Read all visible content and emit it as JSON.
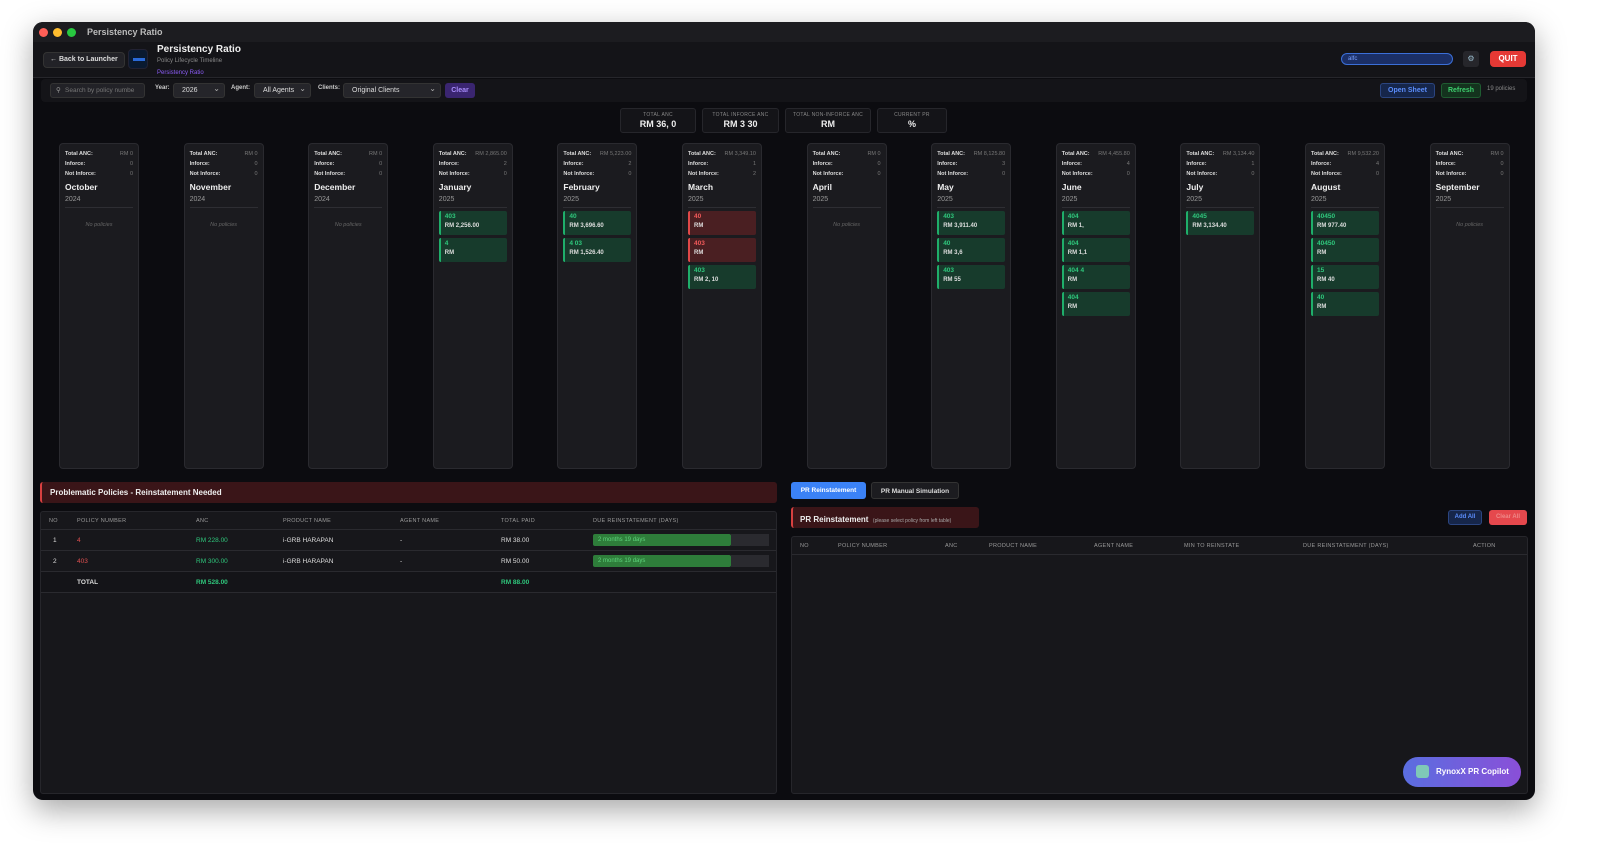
{
  "window": {
    "title": "Persistency Ratio"
  },
  "header": {
    "back": "← Back to Launcher",
    "title": "Persistency Ratio",
    "subtitle": "Policy Lifecycle Timeline",
    "link": "Persistency Ratio",
    "user": "alfc",
    "quit": "QUIT"
  },
  "filters": {
    "search_placeholder": "Search by policy numbe",
    "year_label": "Year:",
    "year": "2026",
    "agent_label": "Agent:",
    "agent": "All Agents",
    "clients_label": "Clients:",
    "clients": "Original Clients",
    "clear": "Clear",
    "open_sheet": "Open Sheet",
    "refresh": "Refresh",
    "count": "19 policies"
  },
  "stats": [
    {
      "label": "TOTAL ANC",
      "value": "RM 36,   0"
    },
    {
      "label": "TOTAL INFORCE ANC",
      "value": "RM 3    30"
    },
    {
      "label": "TOTAL NON-INFORCE ANC",
      "value": "RM"
    },
    {
      "label": "CURRENT PR",
      "value": "%"
    }
  ],
  "month_labels": {
    "total": "Total ANC:",
    "inforce": "Inforce:",
    "not_inforce": "Not Inforce:",
    "none": "No policies"
  },
  "months": [
    {
      "name": "October",
      "year": "2024",
      "total": "RM 0",
      "inforce": "0",
      "not_inforce": "0",
      "policies": []
    },
    {
      "name": "November",
      "year": "2024",
      "total": "RM 0",
      "inforce": "0",
      "not_inforce": "0",
      "policies": []
    },
    {
      "name": "December",
      "year": "2024",
      "total": "RM 0",
      "inforce": "0",
      "not_inforce": "0",
      "policies": []
    },
    {
      "name": "January",
      "year": "2025",
      "total": "RM 2,865.00",
      "inforce": "2",
      "not_inforce": "0",
      "policies": [
        {
          "no": "403",
          "anc": "RM 2,256.00",
          "status": "inforce"
        },
        {
          "no": "4",
          "anc": "RM",
          "status": "inforce"
        }
      ]
    },
    {
      "name": "February",
      "year": "2025",
      "total": "RM 5,223.00",
      "inforce": "2",
      "not_inforce": "0",
      "policies": [
        {
          "no": "40",
          "anc": "RM 3,696.60",
          "status": "inforce"
        },
        {
          "no": "4   03",
          "anc": "RM 1,526.40",
          "status": "inforce"
        }
      ]
    },
    {
      "name": "March",
      "year": "2025",
      "total": "RM 3,349.10",
      "inforce": "1",
      "not_inforce": "2",
      "policies": [
        {
          "no": "40",
          "anc": "RM",
          "status": "lapsed"
        },
        {
          "no": "403",
          "anc": "RM",
          "status": "lapsed"
        },
        {
          "no": "403",
          "anc": "RM 2,   10",
          "status": "inforce"
        }
      ]
    },
    {
      "name": "April",
      "year": "2025",
      "total": "RM 0",
      "inforce": "0",
      "not_inforce": "0",
      "policies": []
    },
    {
      "name": "May",
      "year": "2025",
      "total": "RM 8,125.80",
      "inforce": "3",
      "not_inforce": "0",
      "policies": [
        {
          "no": "403",
          "anc": "RM 3,911.40",
          "status": "inforce"
        },
        {
          "no": "40",
          "anc": "RM 3,6",
          "status": "inforce"
        },
        {
          "no": "403",
          "anc": "RM 55",
          "status": "inforce"
        }
      ]
    },
    {
      "name": "June",
      "year": "2025",
      "total": "RM 4,455.80",
      "inforce": "4",
      "not_inforce": "0",
      "policies": [
        {
          "no": "404",
          "anc": "RM 1,",
          "status": "inforce"
        },
        {
          "no": "404",
          "anc": "RM 1,1",
          "status": "inforce"
        },
        {
          "no": "404    4",
          "anc": "RM",
          "status": "inforce"
        },
        {
          "no": "404",
          "anc": "RM",
          "status": "inforce"
        }
      ]
    },
    {
      "name": "July",
      "year": "2025",
      "total": "RM 3,134.40",
      "inforce": "1",
      "not_inforce": "0",
      "policies": [
        {
          "no": "4045",
          "anc": "RM 3,134.40",
          "status": "inforce"
        }
      ]
    },
    {
      "name": "August",
      "year": "2025",
      "total": "RM 9,532.20",
      "inforce": "4",
      "not_inforce": "0",
      "policies": [
        {
          "no": "40450",
          "anc": "RM 977.40",
          "status": "inforce"
        },
        {
          "no": "40450",
          "anc": "RM",
          "status": "inforce"
        },
        {
          "no": "15",
          "anc": "RM    40",
          "status": "inforce"
        },
        {
          "no": "40",
          "anc": "RM",
          "status": "inforce"
        }
      ]
    },
    {
      "name": "September",
      "year": "2025",
      "total": "RM 0",
      "inforce": "0",
      "not_inforce": "0",
      "policies": []
    }
  ],
  "problematic": {
    "title": "Problematic Policies - Reinstatement Needed",
    "columns": [
      "NO",
      "POLICY NUMBER",
      "ANC",
      "PRODUCT NAME",
      "AGENT NAME",
      "TOTAL PAID",
      "DUE REINSTATEMENT (DAYS)"
    ],
    "rows": [
      {
        "no": "1",
        "policy": "4",
        "anc": "RM 228.00",
        "product": "i-GRB HARAPAN",
        "agent": "-",
        "paid": "RM 38.00",
        "due": "2 months 19 days"
      },
      {
        "no": "2",
        "policy": "403",
        "anc": "RM 300.00",
        "product": "i-GRB HARAPAN",
        "agent": "-",
        "paid": "RM 50.00",
        "due": "2 months 19 days"
      }
    ],
    "total_label": "TOTAL",
    "total_anc": "RM 528.00",
    "total_paid": "RM 88.00"
  },
  "tabs": [
    "PR Reinstatement",
    "PR Manual Simulation"
  ],
  "reinstatement": {
    "title": "PR Reinstatement",
    "hint": "(please select policy from left table)",
    "add_all": "Add All",
    "clear_all": "Clear All",
    "columns": [
      "NO",
      "POLICY NUMBER",
      "ANC",
      "PRODUCT NAME",
      "AGENT NAME",
      "MIN TO REINSTATE",
      "DUE REINSTATEMENT (DAYS)",
      "ACTION"
    ]
  },
  "copilot": "RynoxX PR Copilot",
  "colors": {
    "accent": "#3b82f6",
    "inforce": "#1fae6a",
    "lapsed": "#e04848",
    "quit": "#e53935",
    "purple": "#8b5cf6"
  }
}
